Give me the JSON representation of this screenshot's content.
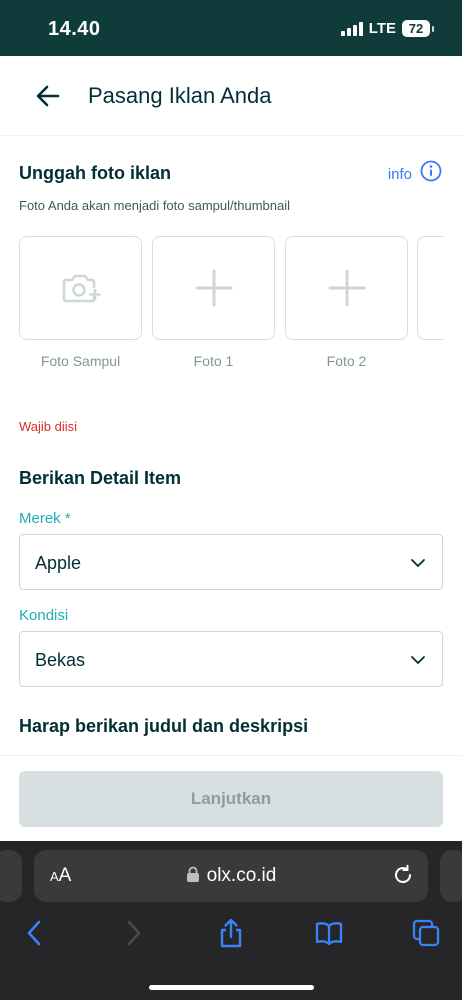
{
  "status_bar": {
    "time": "14.40",
    "network": "LTE",
    "battery": "72"
  },
  "header": {
    "title": "Pasang Iklan Anda"
  },
  "upload": {
    "title": "Unggah foto iklan",
    "info_label": "info",
    "subtitle": "Foto Anda akan menjadi foto sampul/thumbnail",
    "photos": [
      {
        "label": "Foto Sampul",
        "icon": "camera-add-icon"
      },
      {
        "label": "Foto 1",
        "icon": "plus-icon"
      },
      {
        "label": "Foto 2",
        "icon": "plus-icon"
      }
    ],
    "error": "Wajib diisi"
  },
  "details": {
    "title": "Berikan Detail Item",
    "brand": {
      "label": "Merek *",
      "value": "Apple"
    },
    "condition": {
      "label": "Kondisi",
      "value": "Bekas"
    }
  },
  "description": {
    "title": "Harap berikan judul dan deskripsi"
  },
  "footer": {
    "continue_label": "Lanjutkan"
  },
  "browser": {
    "aa_small": "A",
    "aa_large": "A",
    "url": "olx.co.id"
  },
  "colors": {
    "status_bar_bg": "#0f3b3b",
    "text_primary": "#002f34",
    "accent_teal": "#1eadb2",
    "link_blue": "#3a77ff",
    "error_red": "#d93025",
    "button_disabled": "#d8dfe0"
  }
}
